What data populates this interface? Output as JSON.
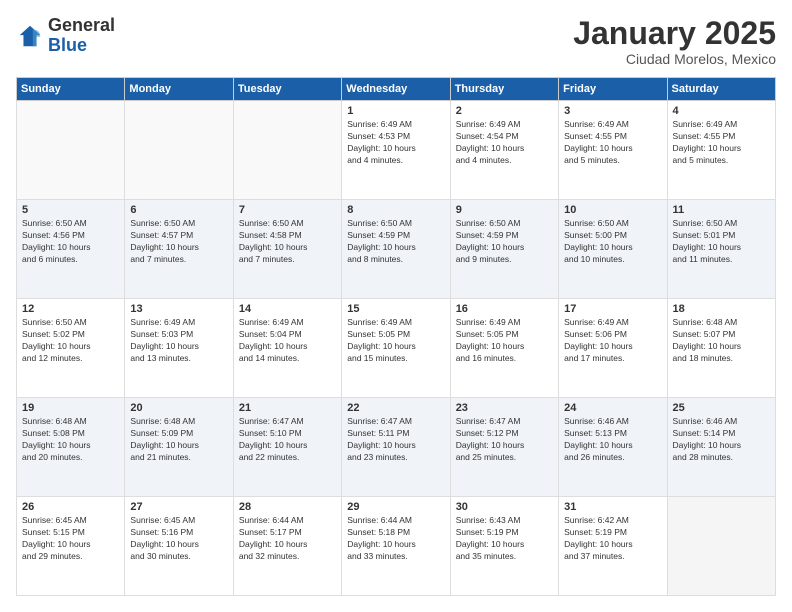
{
  "header": {
    "logo": {
      "general": "General",
      "blue": "Blue"
    },
    "title": "January 2025",
    "subtitle": "Ciudad Morelos, Mexico"
  },
  "weekdays": [
    "Sunday",
    "Monday",
    "Tuesday",
    "Wednesday",
    "Thursday",
    "Friday",
    "Saturday"
  ],
  "weeks": [
    [
      {
        "day": "",
        "info": ""
      },
      {
        "day": "",
        "info": ""
      },
      {
        "day": "",
        "info": ""
      },
      {
        "day": "1",
        "info": "Sunrise: 6:49 AM\nSunset: 4:53 PM\nDaylight: 10 hours\nand 4 minutes."
      },
      {
        "day": "2",
        "info": "Sunrise: 6:49 AM\nSunset: 4:54 PM\nDaylight: 10 hours\nand 4 minutes."
      },
      {
        "day": "3",
        "info": "Sunrise: 6:49 AM\nSunset: 4:55 PM\nDaylight: 10 hours\nand 5 minutes."
      },
      {
        "day": "4",
        "info": "Sunrise: 6:49 AM\nSunset: 4:55 PM\nDaylight: 10 hours\nand 5 minutes."
      }
    ],
    [
      {
        "day": "5",
        "info": "Sunrise: 6:50 AM\nSunset: 4:56 PM\nDaylight: 10 hours\nand 6 minutes."
      },
      {
        "day": "6",
        "info": "Sunrise: 6:50 AM\nSunset: 4:57 PM\nDaylight: 10 hours\nand 7 minutes."
      },
      {
        "day": "7",
        "info": "Sunrise: 6:50 AM\nSunset: 4:58 PM\nDaylight: 10 hours\nand 7 minutes."
      },
      {
        "day": "8",
        "info": "Sunrise: 6:50 AM\nSunset: 4:59 PM\nDaylight: 10 hours\nand 8 minutes."
      },
      {
        "day": "9",
        "info": "Sunrise: 6:50 AM\nSunset: 4:59 PM\nDaylight: 10 hours\nand 9 minutes."
      },
      {
        "day": "10",
        "info": "Sunrise: 6:50 AM\nSunset: 5:00 PM\nDaylight: 10 hours\nand 10 minutes."
      },
      {
        "day": "11",
        "info": "Sunrise: 6:50 AM\nSunset: 5:01 PM\nDaylight: 10 hours\nand 11 minutes."
      }
    ],
    [
      {
        "day": "12",
        "info": "Sunrise: 6:50 AM\nSunset: 5:02 PM\nDaylight: 10 hours\nand 12 minutes."
      },
      {
        "day": "13",
        "info": "Sunrise: 6:49 AM\nSunset: 5:03 PM\nDaylight: 10 hours\nand 13 minutes."
      },
      {
        "day": "14",
        "info": "Sunrise: 6:49 AM\nSunset: 5:04 PM\nDaylight: 10 hours\nand 14 minutes."
      },
      {
        "day": "15",
        "info": "Sunrise: 6:49 AM\nSunset: 5:05 PM\nDaylight: 10 hours\nand 15 minutes."
      },
      {
        "day": "16",
        "info": "Sunrise: 6:49 AM\nSunset: 5:05 PM\nDaylight: 10 hours\nand 16 minutes."
      },
      {
        "day": "17",
        "info": "Sunrise: 6:49 AM\nSunset: 5:06 PM\nDaylight: 10 hours\nand 17 minutes."
      },
      {
        "day": "18",
        "info": "Sunrise: 6:48 AM\nSunset: 5:07 PM\nDaylight: 10 hours\nand 18 minutes."
      }
    ],
    [
      {
        "day": "19",
        "info": "Sunrise: 6:48 AM\nSunset: 5:08 PM\nDaylight: 10 hours\nand 20 minutes."
      },
      {
        "day": "20",
        "info": "Sunrise: 6:48 AM\nSunset: 5:09 PM\nDaylight: 10 hours\nand 21 minutes."
      },
      {
        "day": "21",
        "info": "Sunrise: 6:47 AM\nSunset: 5:10 PM\nDaylight: 10 hours\nand 22 minutes."
      },
      {
        "day": "22",
        "info": "Sunrise: 6:47 AM\nSunset: 5:11 PM\nDaylight: 10 hours\nand 23 minutes."
      },
      {
        "day": "23",
        "info": "Sunrise: 6:47 AM\nSunset: 5:12 PM\nDaylight: 10 hours\nand 25 minutes."
      },
      {
        "day": "24",
        "info": "Sunrise: 6:46 AM\nSunset: 5:13 PM\nDaylight: 10 hours\nand 26 minutes."
      },
      {
        "day": "25",
        "info": "Sunrise: 6:46 AM\nSunset: 5:14 PM\nDaylight: 10 hours\nand 28 minutes."
      }
    ],
    [
      {
        "day": "26",
        "info": "Sunrise: 6:45 AM\nSunset: 5:15 PM\nDaylight: 10 hours\nand 29 minutes."
      },
      {
        "day": "27",
        "info": "Sunrise: 6:45 AM\nSunset: 5:16 PM\nDaylight: 10 hours\nand 30 minutes."
      },
      {
        "day": "28",
        "info": "Sunrise: 6:44 AM\nSunset: 5:17 PM\nDaylight: 10 hours\nand 32 minutes."
      },
      {
        "day": "29",
        "info": "Sunrise: 6:44 AM\nSunset: 5:18 PM\nDaylight: 10 hours\nand 33 minutes."
      },
      {
        "day": "30",
        "info": "Sunrise: 6:43 AM\nSunset: 5:19 PM\nDaylight: 10 hours\nand 35 minutes."
      },
      {
        "day": "31",
        "info": "Sunrise: 6:42 AM\nSunset: 5:19 PM\nDaylight: 10 hours\nand 37 minutes."
      },
      {
        "day": "",
        "info": ""
      }
    ]
  ]
}
